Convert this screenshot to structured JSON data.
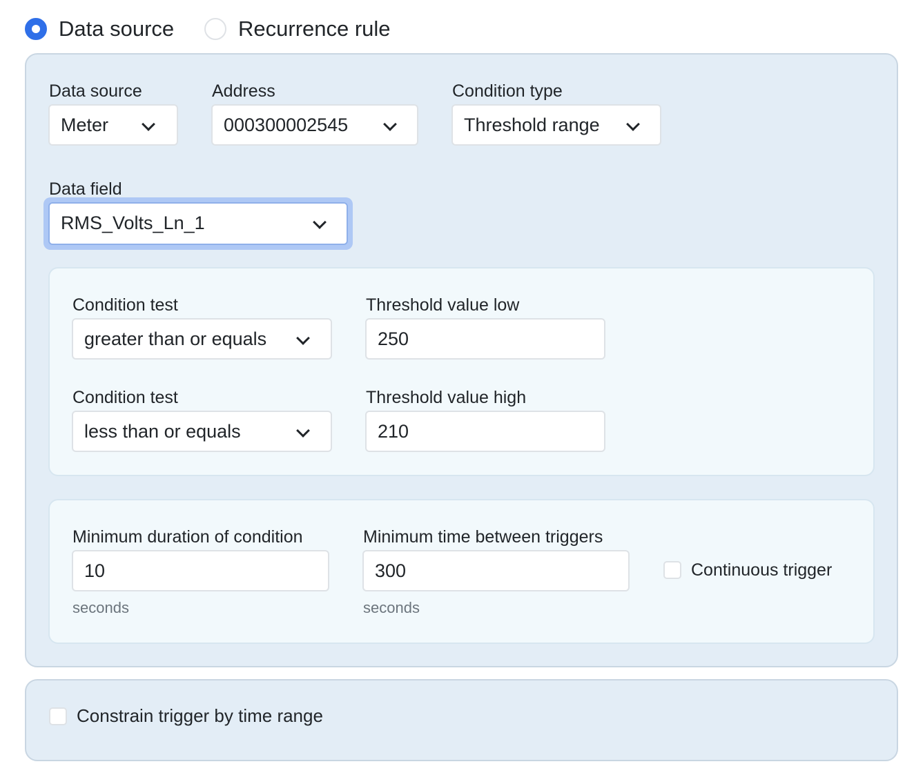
{
  "mode": {
    "options": [
      {
        "label": "Data source",
        "checked": true
      },
      {
        "label": "Recurrence rule",
        "checked": false
      }
    ]
  },
  "source": {
    "data_source": {
      "label": "Data source",
      "value": "Meter"
    },
    "address": {
      "label": "Address",
      "value": "000300002545"
    },
    "condition_type": {
      "label": "Condition type",
      "value": "Threshold range"
    },
    "data_field": {
      "label": "Data field",
      "value": "RMS_Volts_Ln_1"
    }
  },
  "conditions": {
    "low": {
      "test_label": "Condition test",
      "test_value": "greater than or equals",
      "threshold_label": "Threshold value low",
      "threshold_value": "250"
    },
    "high": {
      "test_label": "Condition test",
      "test_value": "less than or equals",
      "threshold_label": "Threshold value high",
      "threshold_value": "210"
    }
  },
  "timing": {
    "min_duration": {
      "label": "Minimum duration of condition",
      "value": "10",
      "unit": "seconds"
    },
    "min_between": {
      "label": "Minimum time between triggers",
      "value": "300",
      "unit": "seconds"
    },
    "continuous": {
      "label": "Continuous trigger",
      "checked": false
    }
  },
  "constraint": {
    "label": "Constrain trigger by time range",
    "checked": false
  },
  "colors": {
    "accent": "#2f6fe8",
    "panel": "#e3edf6",
    "subpanel": "#f2f9fc"
  }
}
